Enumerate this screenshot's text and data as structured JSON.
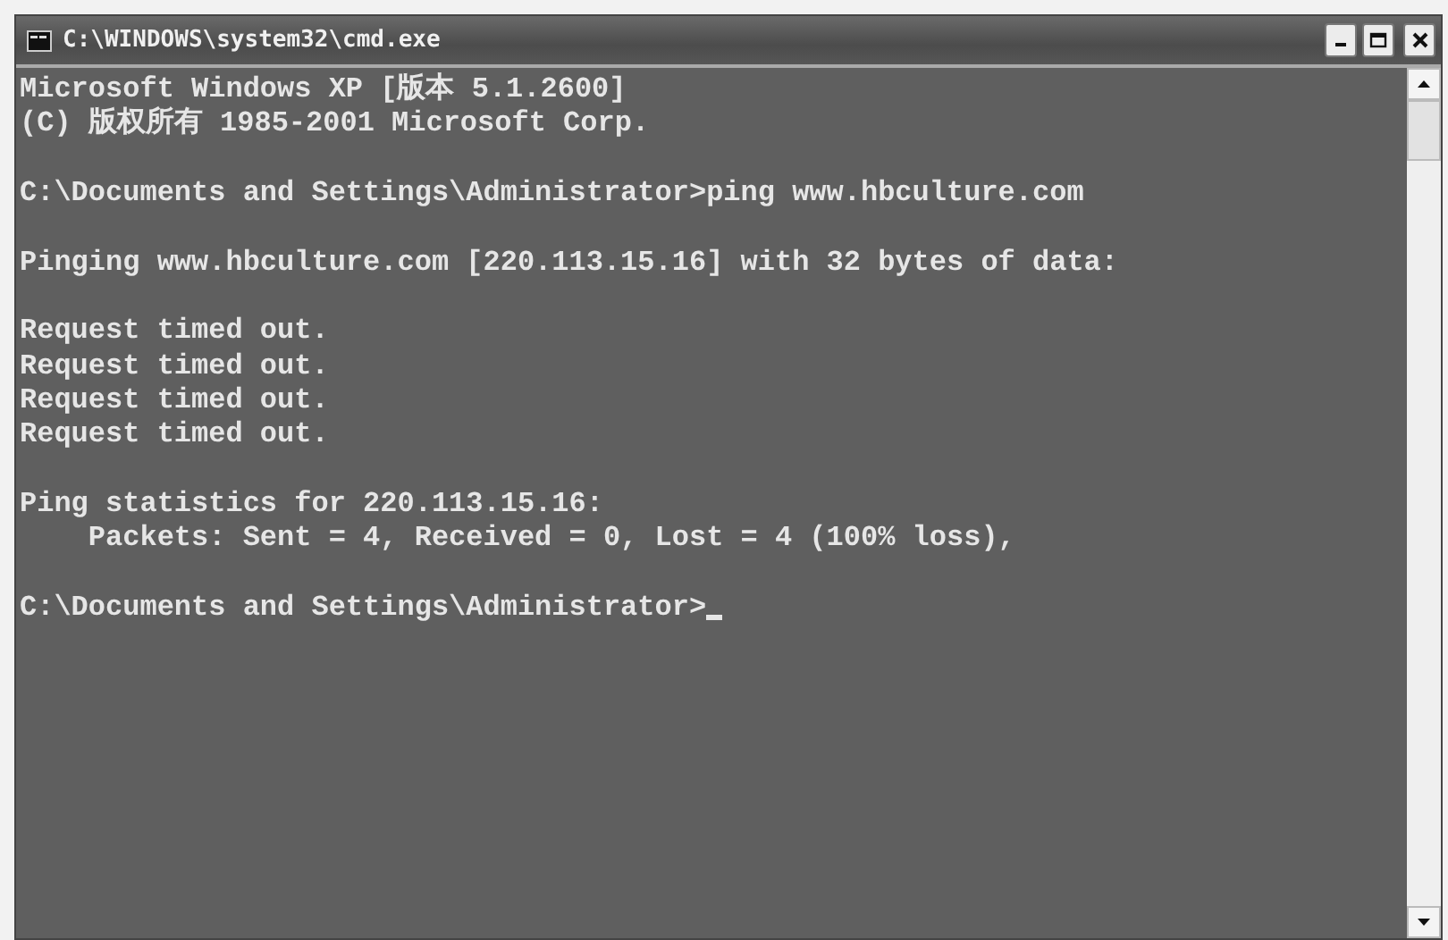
{
  "window": {
    "title": "C:\\WINDOWS\\system32\\cmd.exe"
  },
  "console": {
    "blocks": [
      [
        "Microsoft Windows XP [版本 5.1.2600]",
        "(C) 版权所有 1985-2001 Microsoft Corp."
      ],
      [
        "C:\\Documents and Settings\\Administrator>ping www.hbculture.com"
      ],
      [
        "Pinging www.hbculture.com [220.113.15.16] with 32 bytes of data:"
      ],
      [
        "Request timed out.",
        "Request timed out.",
        "Request timed out.",
        "Request timed out."
      ],
      [
        "Ping statistics for 220.113.15.16:",
        "    Packets: Sent = 4, Received = 0, Lost = 4 (100% loss),"
      ],
      [
        "C:\\Documents and Settings\\Administrator>"
      ]
    ],
    "cursor_visible": true
  }
}
